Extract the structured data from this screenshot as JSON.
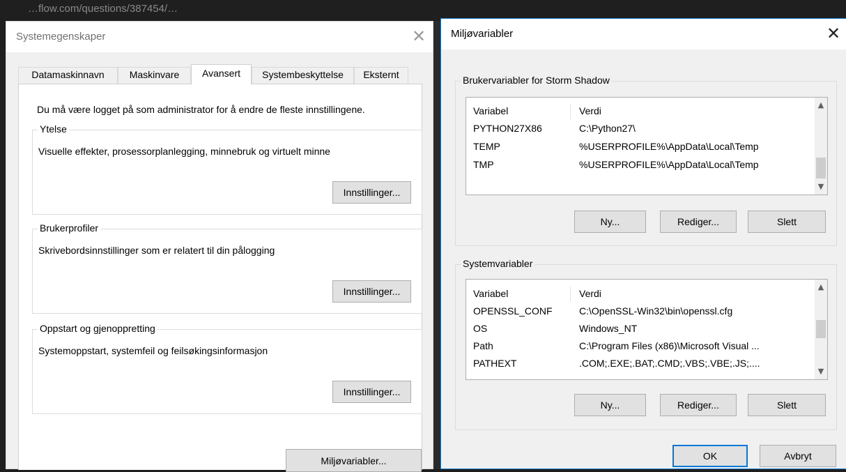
{
  "backdrop_text": "…flow.com/questions/387454/…",
  "system_props": {
    "title": "Systemegenskaper",
    "tabs": [
      {
        "label": "Datamaskinnavn",
        "active": false
      },
      {
        "label": "Maskinvare",
        "active": false
      },
      {
        "label": "Avansert",
        "active": true
      },
      {
        "label": "Systembeskyttelse",
        "active": false
      },
      {
        "label": "Eksternt",
        "active": false
      }
    ],
    "admin_note": "Du må være logget på som administrator for å endre de fleste innstillingene.",
    "performance": {
      "label": "Ytelse",
      "description": "Visuelle effekter, prosessorplanlegging, minnebruk og virtuelt minne",
      "button": "Innstillinger..."
    },
    "user_profiles": {
      "label": "Brukerprofiler",
      "description": "Skrivebordsinnstillinger som er relatert til din pålogging",
      "button": "Innstillinger..."
    },
    "startup_recovery": {
      "label": "Oppstart og gjenoppretting",
      "description": "Systemoppstart, systemfeil og feilsøkingsinformasjon",
      "button": "Innstillinger..."
    },
    "env_button": "Miljøvariabler..."
  },
  "env_vars": {
    "title": "Miljøvariabler",
    "user_section": {
      "label": "Brukervariabler for Storm Shadow",
      "columns": [
        "Variabel",
        "Verdi"
      ],
      "rows": [
        {
          "name": "PYTHON27X86",
          "value": "C:\\Python27\\"
        },
        {
          "name": "TEMP",
          "value": "%USERPROFILE%\\AppData\\Local\\Temp"
        },
        {
          "name": "TMP",
          "value": "%USERPROFILE%\\AppData\\Local\\Temp"
        }
      ],
      "buttons": {
        "new": "Ny...",
        "edit": "Rediger...",
        "delete": "Slett"
      }
    },
    "system_section": {
      "label": "Systemvariabler",
      "columns": [
        "Variabel",
        "Verdi"
      ],
      "rows": [
        {
          "name": "OPENSSL_CONF",
          "value": "C:\\OpenSSL-Win32\\bin\\openssl.cfg"
        },
        {
          "name": "OS",
          "value": "Windows_NT"
        },
        {
          "name": "Path",
          "value": "C:\\Program Files (x86)\\Microsoft Visual ..."
        },
        {
          "name": "PATHEXT",
          "value": ".COM;.EXE;.BAT;.CMD;.VBS;.VBE;.JS;...."
        }
      ],
      "buttons": {
        "new": "Ny...",
        "edit": "Rediger...",
        "delete": "Slett"
      }
    },
    "ok": "OK",
    "cancel": "Avbryt"
  },
  "colors": {
    "accent": "#0078d7",
    "window_bg": "#f0f0f0",
    "panel_bg": "#ffffff"
  }
}
